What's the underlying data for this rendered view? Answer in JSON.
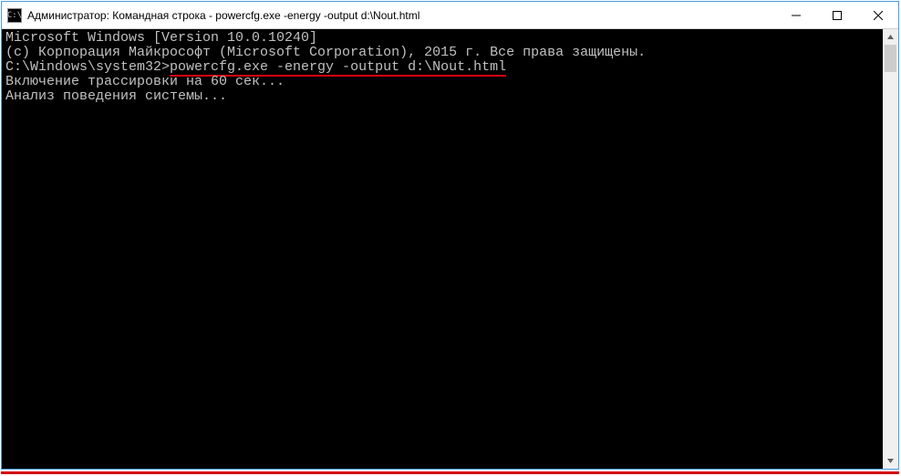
{
  "titlebar": {
    "icon_label": "C:\\",
    "title": "Администратор: Командная строка - powercfg.exe  -energy -output d:\\Nout.html"
  },
  "terminal": {
    "line1": "Microsoft Windows [Version 10.0.10240]",
    "line2": "(c) Корпорация Майкрософт (Microsoft Corporation), 2015 г. Все права защищены.",
    "blank": "",
    "prompt": "C:\\Windows\\system32>",
    "command": "powercfg.exe -energy -output d:\\Nout.html",
    "line4": "Включение трассировки на 60 сек...",
    "line5": "Анализ поведения системы..."
  }
}
